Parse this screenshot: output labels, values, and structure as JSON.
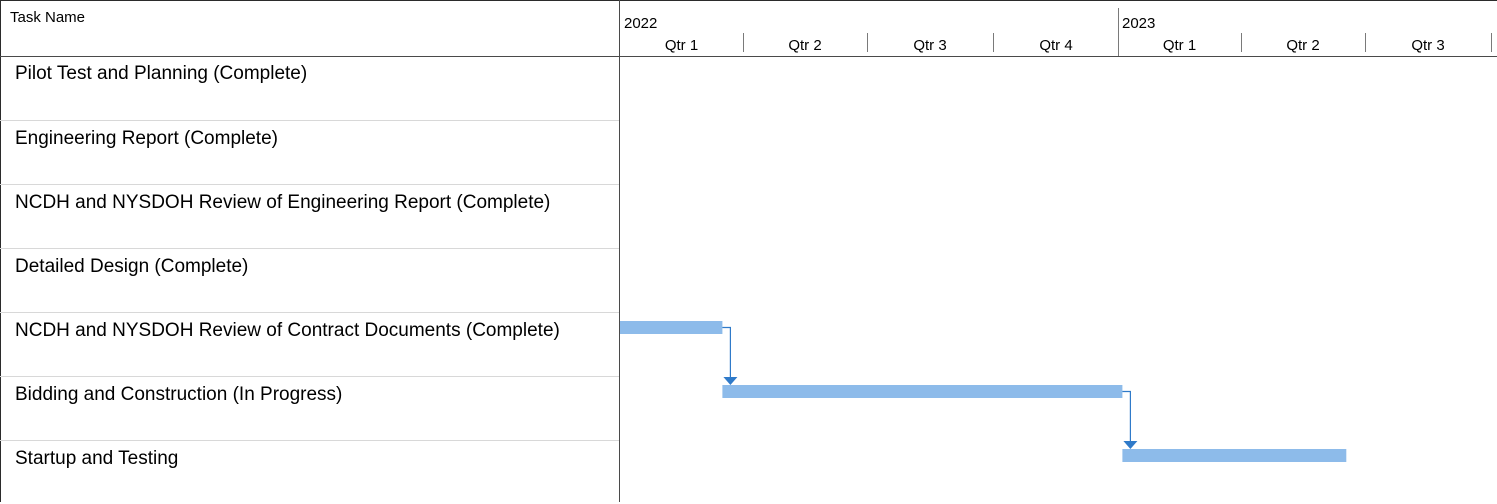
{
  "chart_data": {
    "type": "gantt",
    "task_column_header": "Task Name",
    "timescale": {
      "start": "2022-01-01",
      "end": "2023-09-30",
      "years": [
        {
          "label": "2022",
          "start": "2022-01-01"
        },
        {
          "label": "2023",
          "start": "2023-01-01"
        }
      ],
      "quarters": [
        {
          "label": "Qtr 1",
          "start": "2022-01-01"
        },
        {
          "label": "Qtr 2",
          "start": "2022-04-01"
        },
        {
          "label": "Qtr 3",
          "start": "2022-07-01"
        },
        {
          "label": "Qtr 4",
          "start": "2022-10-01"
        },
        {
          "label": "Qtr 1",
          "start": "2023-01-01"
        },
        {
          "label": "Qtr 2",
          "start": "2023-04-01"
        },
        {
          "label": "Qtr 3",
          "start": "2023-07-01"
        }
      ]
    },
    "tasks": [
      {
        "name": "Pilot Test and Planning (Complete)",
        "start": null,
        "end": null
      },
      {
        "name": "Engineering Report (Complete)",
        "start": null,
        "end": null
      },
      {
        "name": "NCDH and NYSDOH Review of Engineering Report (Complete)",
        "start": null,
        "end": null
      },
      {
        "name": "Detailed Design (Complete)",
        "start": null,
        "end": null
      },
      {
        "name": "NCDH and NYSDOH Review of Contract Documents (Complete)",
        "start": "2022-01-01",
        "end": "2022-03-17"
      },
      {
        "name": "Bidding and Construction (In Progress)",
        "start": "2022-03-17",
        "end": "2023-01-04"
      },
      {
        "name": "Startup and Testing",
        "start": "2023-01-04",
        "end": "2023-06-17"
      }
    ],
    "links": [
      {
        "from": 4,
        "to": 5
      },
      {
        "from": 5,
        "to": 6
      }
    ],
    "colors": {
      "bar": "#8dbbea",
      "link": "#2f7ac9",
      "grid": "#d8d8d8"
    }
  }
}
